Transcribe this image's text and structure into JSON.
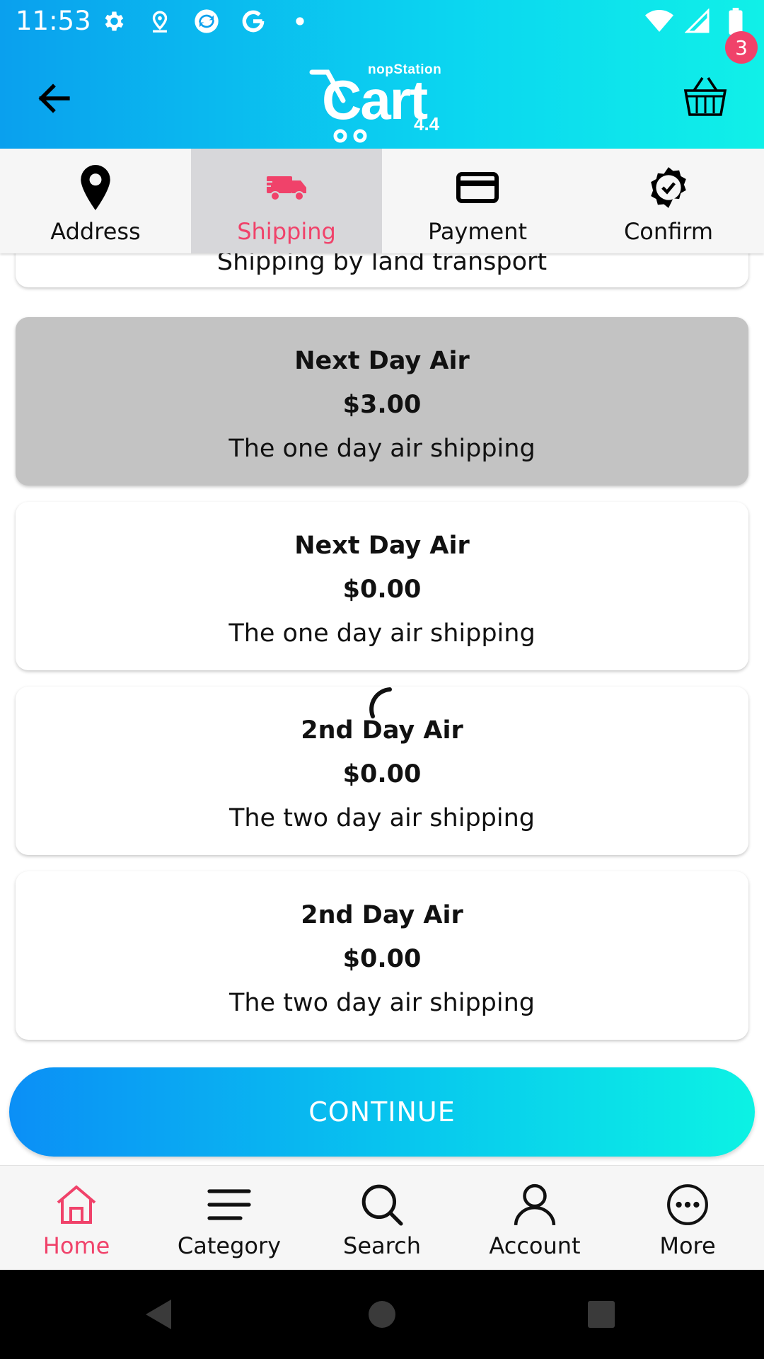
{
  "status_bar": {
    "time": "11:53",
    "left_icons": [
      "settings-icon",
      "location-icon",
      "sync-icon",
      "google-icon",
      "dot-icon"
    ],
    "right_icons": [
      "wifi-icon",
      "signal-icon",
      "battery-icon"
    ]
  },
  "header": {
    "logo_brand": "nopStation",
    "logo_word": "Cart",
    "logo_version": "4.4",
    "cart_badge": "3",
    "colors": {
      "gradient_start": "#0aa0ee",
      "gradient_end": "#10f0e8",
      "badge": "#f0426a"
    }
  },
  "steps": [
    {
      "label": "Address",
      "icon": "location-pin-icon",
      "active": false
    },
    {
      "label": "Shipping",
      "icon": "truck-icon",
      "active": true
    },
    {
      "label": "Payment",
      "icon": "credit-card-icon",
      "active": false
    },
    {
      "label": "Confirm",
      "icon": "check-badge-icon",
      "active": false
    }
  ],
  "shipping_options": [
    {
      "name": "",
      "price": "",
      "description": "Shipping by land transport",
      "selected": false
    },
    {
      "name": "Next Day Air",
      "price": "$3.00",
      "description": "The one day air shipping",
      "selected": true
    },
    {
      "name": "Next Day Air",
      "price": "$0.00",
      "description": "The one day air shipping",
      "selected": false
    },
    {
      "name": "2nd Day Air",
      "price": "$0.00",
      "description": "The two day air shipping",
      "selected": false
    },
    {
      "name": "2nd Day Air",
      "price": "$0.00",
      "description": "The two day air shipping",
      "selected": false
    }
  ],
  "continue_label": "CONTINUE",
  "bottom_nav": [
    {
      "label": "Home",
      "icon": "home-icon",
      "active": true
    },
    {
      "label": "Category",
      "icon": "menu-icon",
      "active": false
    },
    {
      "label": "Search",
      "icon": "search-icon",
      "active": false
    },
    {
      "label": "Account",
      "icon": "account-icon",
      "active": false
    },
    {
      "label": "More",
      "icon": "more-icon",
      "active": false
    }
  ],
  "accent_color": "#f0426a"
}
